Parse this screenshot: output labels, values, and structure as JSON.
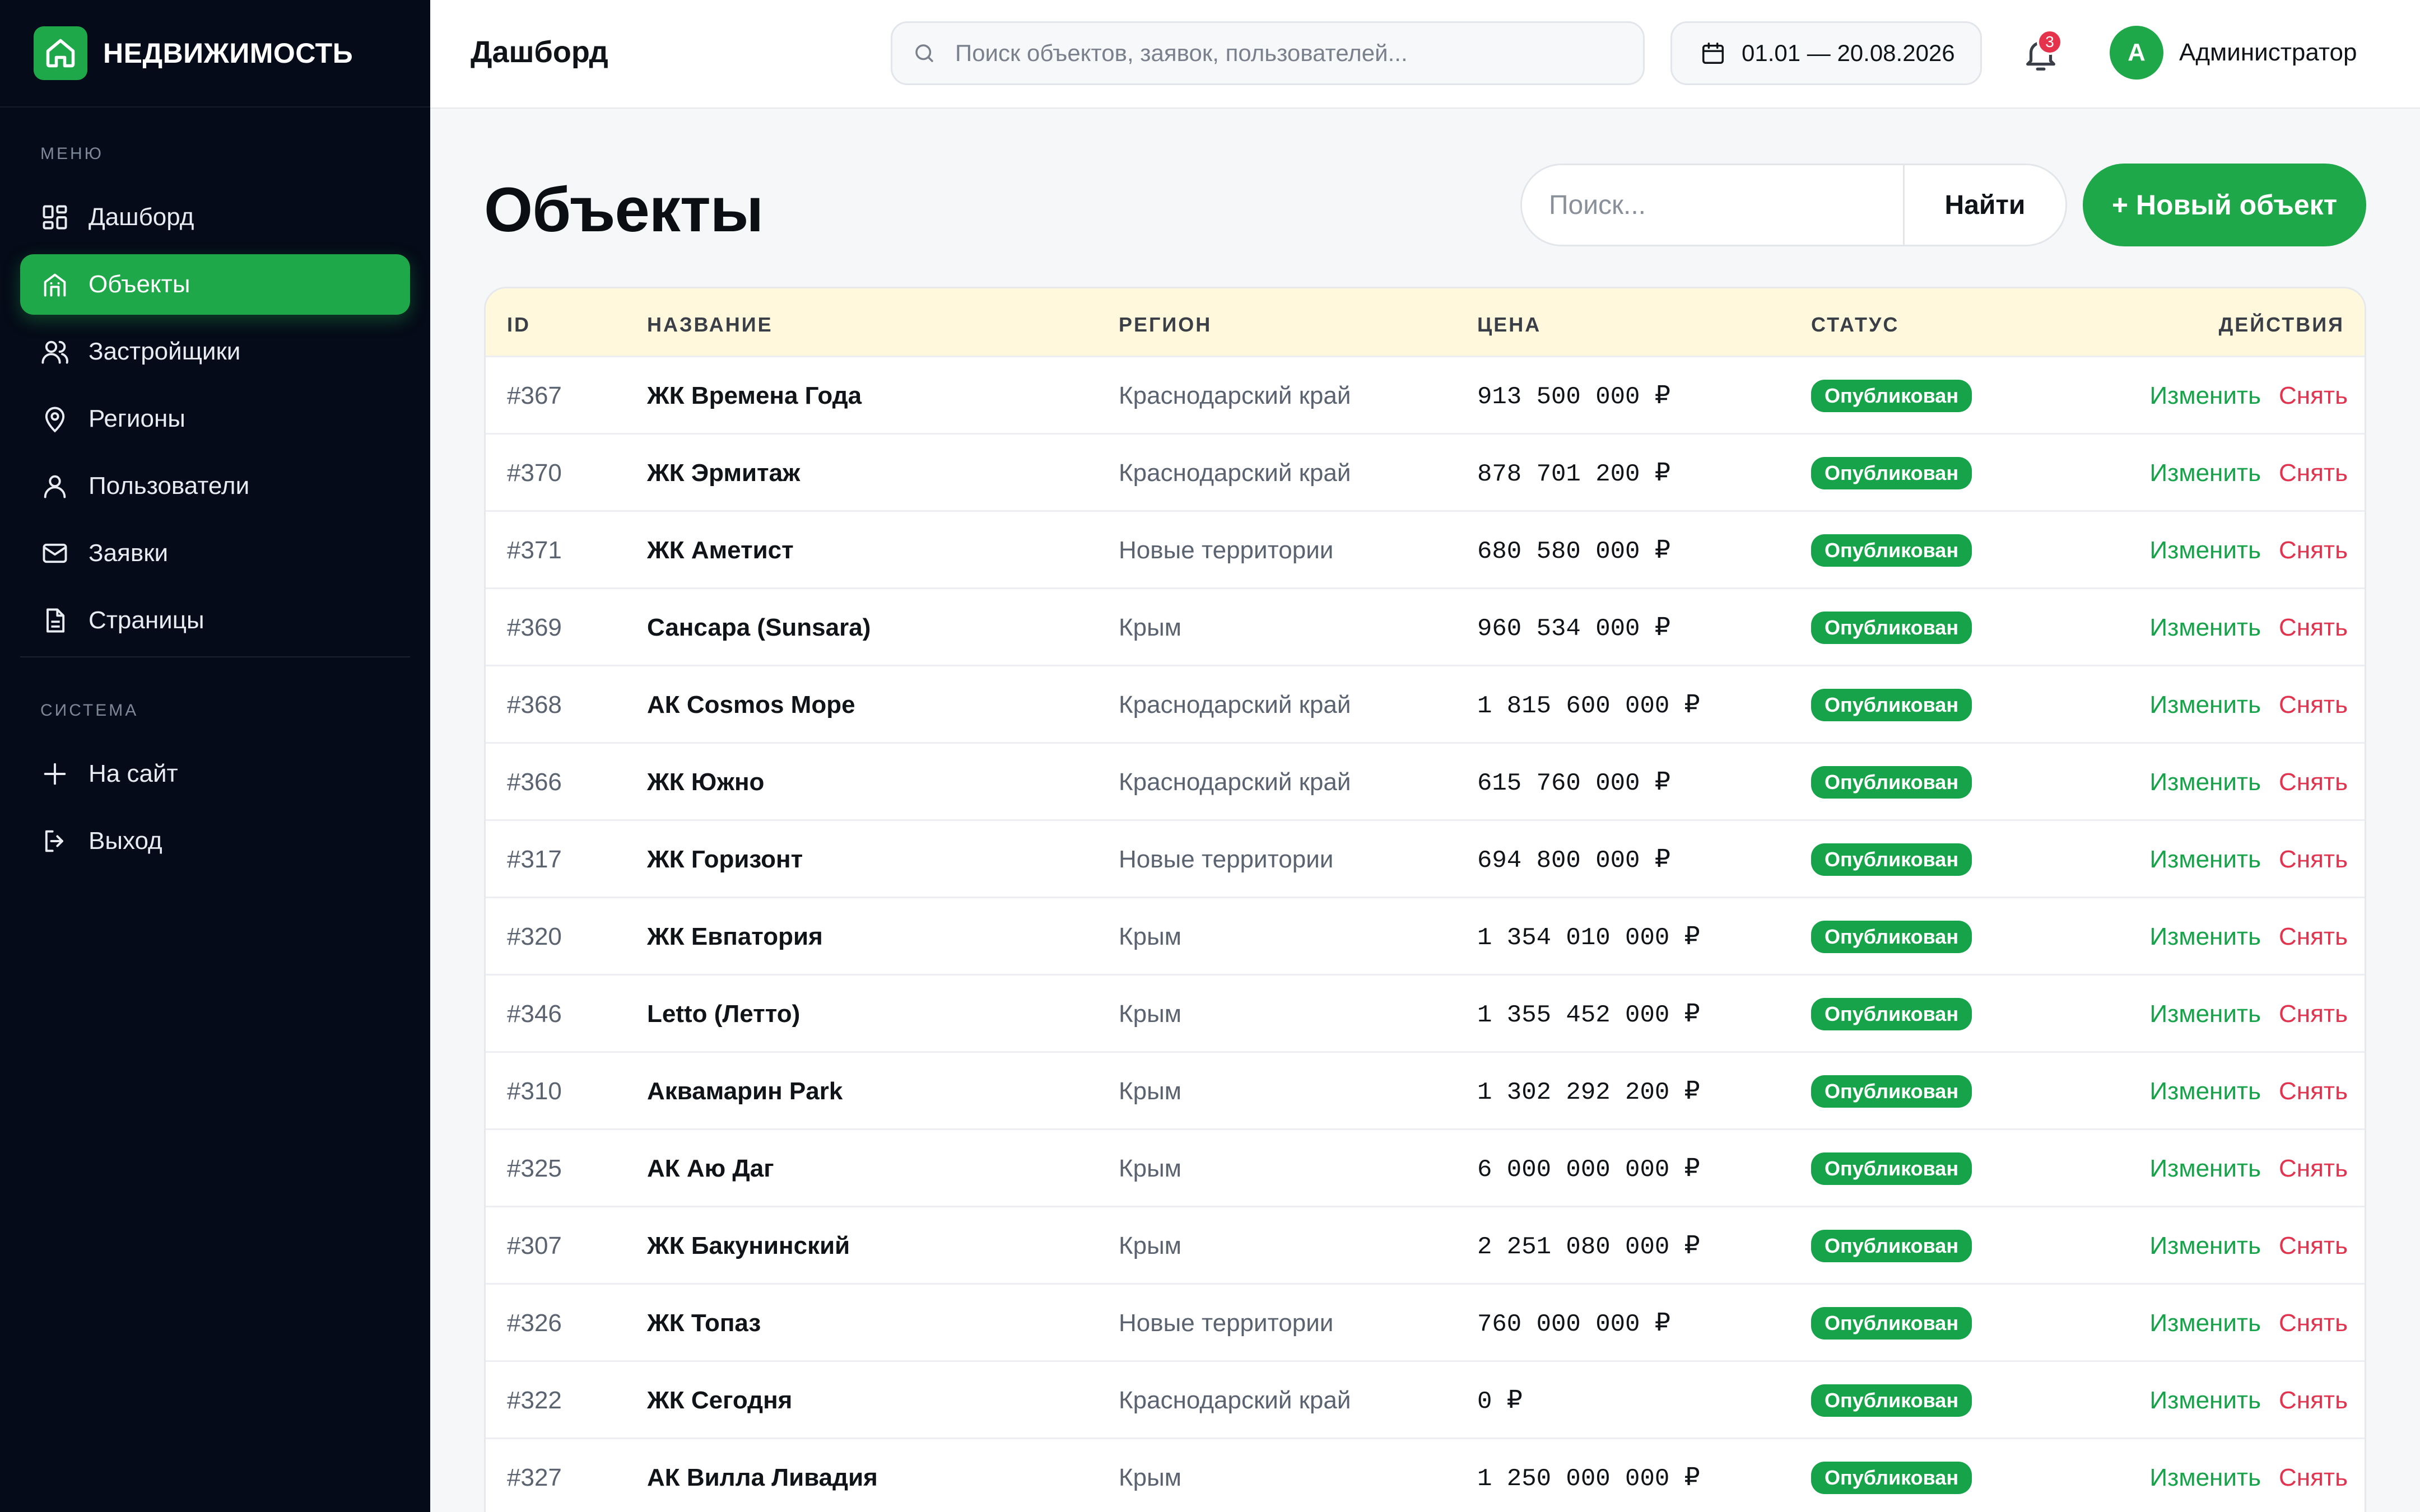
{
  "brand": {
    "name": "НЕДВИЖИМОСТЬ"
  },
  "sidebar": {
    "menu_label": "МЕНЮ",
    "system_label": "СИСТЕМА",
    "items": [
      {
        "label": "Дашборд"
      },
      {
        "label": "Объекты"
      },
      {
        "label": "Застройщики"
      },
      {
        "label": "Регионы"
      },
      {
        "label": "Пользователи"
      },
      {
        "label": "Заявки"
      },
      {
        "label": "Страницы"
      }
    ],
    "system_items": [
      {
        "label": "На сайт"
      },
      {
        "label": "Выход"
      }
    ]
  },
  "header": {
    "title": "Дашборд",
    "search_placeholder": "Поиск объектов, заявок, пользователей...",
    "date_range": "01.01 — 20.08.2026",
    "notifications_count": "3",
    "user_initial": "А",
    "user_name": "Администратор"
  },
  "main": {
    "title": "Объекты",
    "search_placeholder": "Поиск...",
    "find_label": "Найти",
    "new_label": "+ Новый объект",
    "columns": [
      "ID",
      "НАЗВАНИЕ",
      "РЕГИОН",
      "ЦЕНА",
      "СТАТУС",
      "ДЕЙСТВИЯ"
    ],
    "edit_label": "Изменить",
    "remove_label": "Снять",
    "rows": [
      {
        "id": "#367",
        "name": "ЖК Времена Года",
        "region": "Краснодарский край",
        "price": "913 500 000 ₽",
        "status": "Опубликован"
      },
      {
        "id": "#370",
        "name": "ЖК Эрмитаж",
        "region": "Краснодарский край",
        "price": "878 701 200 ₽",
        "status": "Опубликован"
      },
      {
        "id": "#371",
        "name": "ЖК Аметист",
        "region": "Новые территории",
        "price": "680 580 000 ₽",
        "status": "Опубликован"
      },
      {
        "id": "#369",
        "name": "Сансара (Sunsara)",
        "region": "Крым",
        "price": "960 534 000 ₽",
        "status": "Опубликован"
      },
      {
        "id": "#368",
        "name": "АК Cosmos Море",
        "region": "Краснодарский край",
        "price": "1 815 600 000 ₽",
        "status": "Опубликован"
      },
      {
        "id": "#366",
        "name": "ЖК Южно",
        "region": "Краснодарский край",
        "price": "615 760 000 ₽",
        "status": "Опубликован"
      },
      {
        "id": "#317",
        "name": "ЖК Горизонт",
        "region": "Новые территории",
        "price": "694 800 000 ₽",
        "status": "Опубликован"
      },
      {
        "id": "#320",
        "name": "ЖК Евпатория",
        "region": "Крым",
        "price": "1 354 010 000 ₽",
        "status": "Опубликован"
      },
      {
        "id": "#346",
        "name": "Letto (Летто)",
        "region": "Крым",
        "price": "1 355 452 000 ₽",
        "status": "Опубликован"
      },
      {
        "id": "#310",
        "name": "Аквамарин Park",
        "region": "Крым",
        "price": "1 302 292 200 ₽",
        "status": "Опубликован"
      },
      {
        "id": "#325",
        "name": "АК Аю Даг",
        "region": "Крым",
        "price": "6 000 000 000 ₽",
        "status": "Опубликован"
      },
      {
        "id": "#307",
        "name": "ЖК Бакунинский",
        "region": "Крым",
        "price": "2 251 080 000 ₽",
        "status": "Опубликован"
      },
      {
        "id": "#326",
        "name": "ЖК Топаз",
        "region": "Новые территории",
        "price": "760 000 000 ₽",
        "status": "Опубликован"
      },
      {
        "id": "#322",
        "name": "ЖК Сегодня",
        "region": "Краснодарский край",
        "price": "0 ₽",
        "status": "Опубликован"
      },
      {
        "id": "#327",
        "name": "АК Вилла Ливадия",
        "region": "Крым",
        "price": "1 250 000 000 ₽",
        "status": "Опубликован"
      }
    ]
  },
  "colors": {
    "accent": "#1fa84a",
    "sidebar_bg": "#050b18",
    "danger": "#e2334f",
    "header_row": "#fff8dc"
  }
}
